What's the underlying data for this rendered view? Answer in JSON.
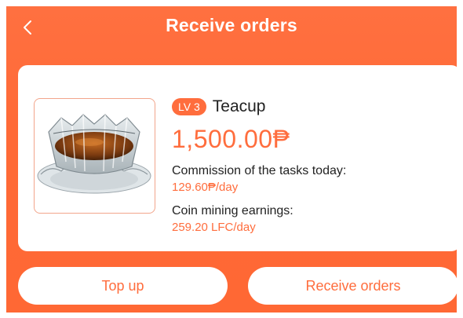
{
  "header": {
    "title": "Receive orders",
    "back_icon": "chevron-left-icon"
  },
  "product": {
    "level_badge": "LV 3",
    "name": "Teacup",
    "price": "1,500.00₱",
    "commission_label": "Commission of the tasks today:",
    "commission_value": "129.60₱/day",
    "mining_label": "Coin mining earnings:",
    "mining_value": "259.20 LFC/day"
  },
  "actions": {
    "top_up": "Top up",
    "receive_orders": "Receive orders"
  },
  "colors": {
    "accent": "#ff6d3d",
    "header_bg": "#ff6a37",
    "card_bg": "#ffffff"
  }
}
